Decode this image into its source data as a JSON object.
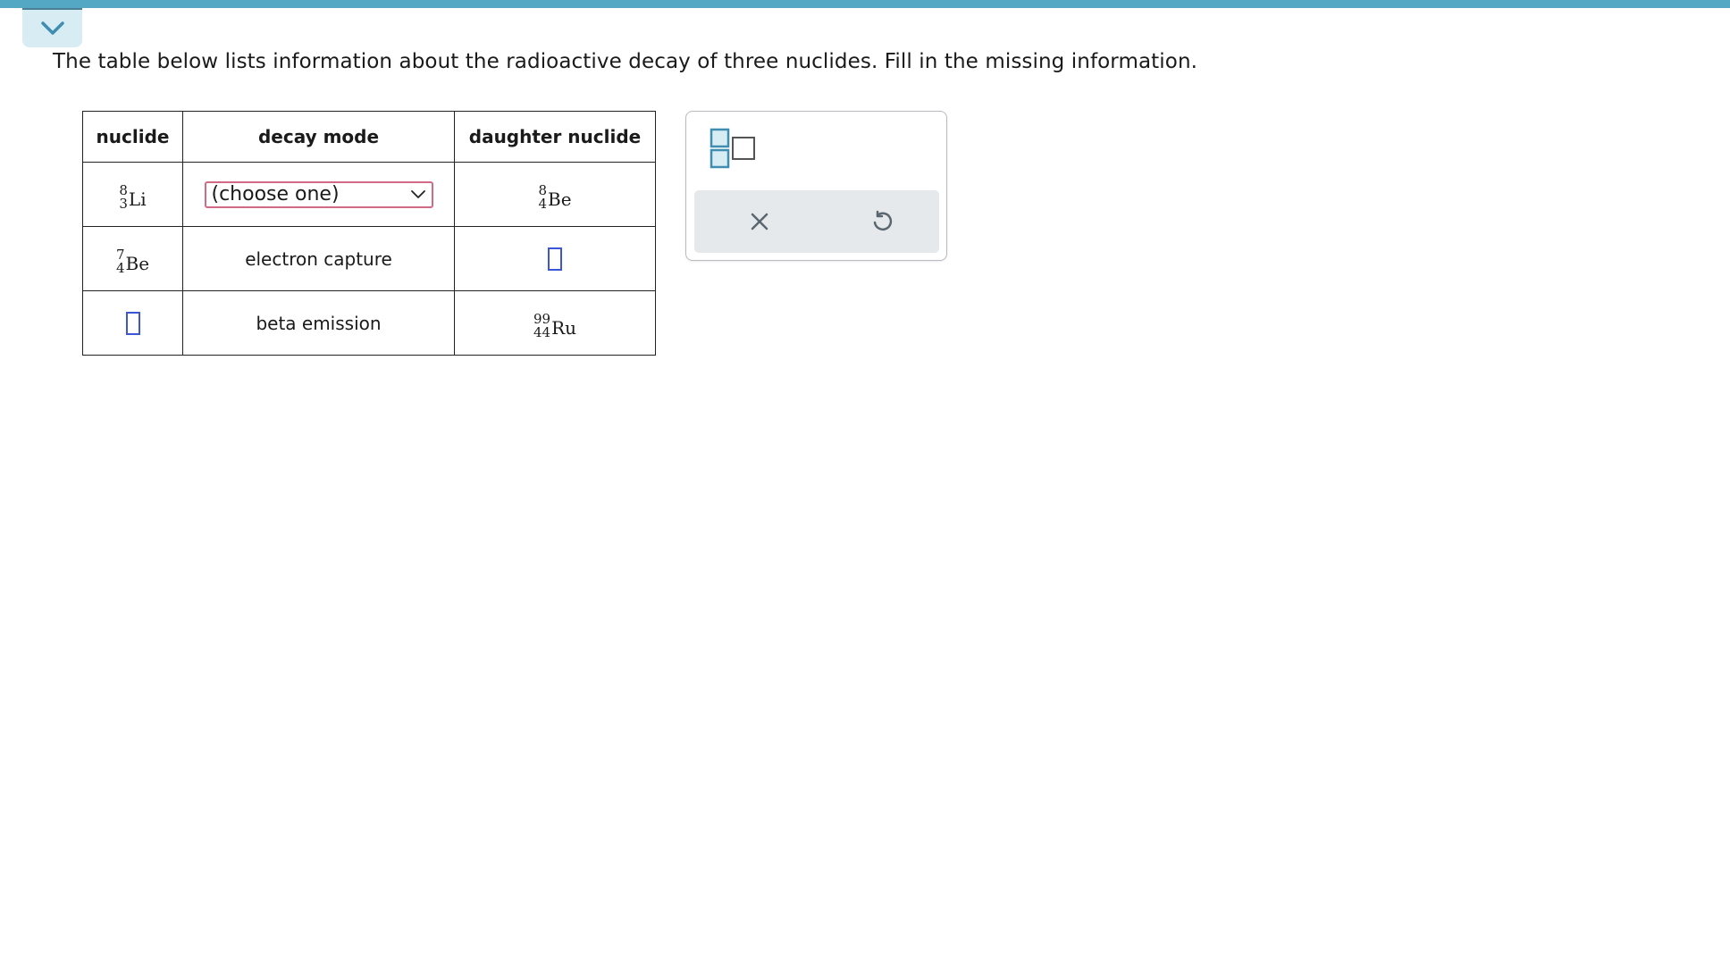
{
  "colors": {
    "top_bar": "#55a8c4",
    "collapse_tab_bg": "#d7ecf3",
    "chevron": "#3f8db0",
    "select_border": "#d26a86",
    "answer_box_border": "#3b57d6",
    "template_icon": "#3f8db0",
    "action_icon": "#5a6770"
  },
  "collapse_tab": {
    "icon": "chevron-down-icon"
  },
  "prompt": "The table below lists information about the radioactive decay of three nuclides. Fill in the missing information.",
  "table": {
    "headers": {
      "nuclide": "nuclide",
      "decay_mode": "decay mode",
      "daughter": "daughter nuclide"
    },
    "rows": [
      {
        "nuclide": {
          "mass": "8",
          "atomic": "3",
          "symbol": "Li"
        },
        "decay_mode": {
          "type": "select",
          "value": "(choose one)"
        },
        "daughter": {
          "mass": "8",
          "atomic": "4",
          "symbol": "Be"
        }
      },
      {
        "nuclide": {
          "mass": "7",
          "atomic": "4",
          "symbol": "Be"
        },
        "decay_mode": {
          "type": "text",
          "value": "electron capture"
        },
        "daughter": {
          "type": "answer-box"
        }
      },
      {
        "nuclide": {
          "type": "answer-box"
        },
        "decay_mode": {
          "type": "text",
          "value": "beta emission"
        },
        "daughter": {
          "mass": "99",
          "atomic": "44",
          "symbol": "Ru"
        }
      }
    ]
  },
  "tool_panel": {
    "template_icon": "superscript-subscript-template-icon",
    "clear_icon": "close-icon",
    "undo_icon": "undo-icon"
  }
}
